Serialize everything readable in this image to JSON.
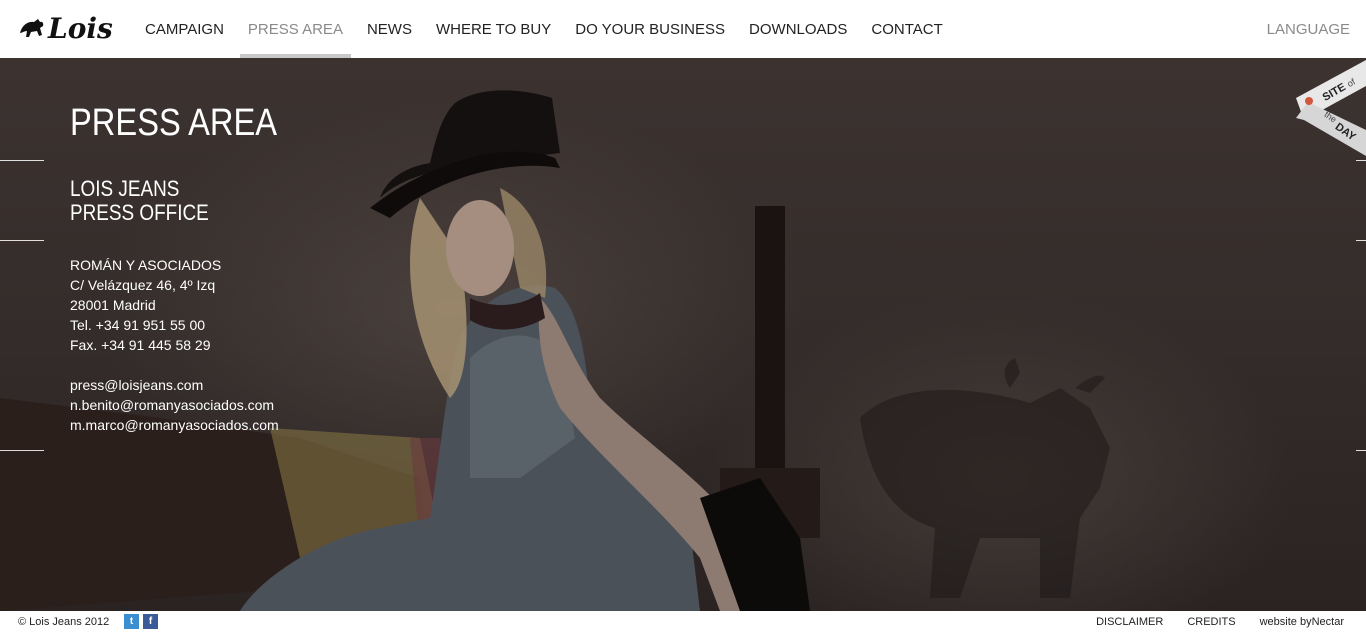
{
  "brand": {
    "logo_text": "Lois"
  },
  "nav": {
    "items": [
      {
        "label": "CAMPAIGN"
      },
      {
        "label": "PRESS AREA"
      },
      {
        "label": "NEWS"
      },
      {
        "label": "WHERE TO BUY"
      },
      {
        "label": "DO YOUR BUSINESS"
      },
      {
        "label": "DOWNLOADS"
      },
      {
        "label": "CONTACT"
      }
    ],
    "active": "PRESS AREA",
    "language": "LANGUAGE"
  },
  "main": {
    "title": "PRESS AREA",
    "office_line1": "LOIS JEANS",
    "office_line2": "PRESS OFFICE",
    "address": [
      "ROMÁN Y ASOCIADOS",
      "C/ Velázquez 46, 4º Izq",
      "28001 Madrid",
      "Tel. +34 91 951 55 00",
      "Fax. +34 91 445 58 29"
    ],
    "emails": [
      "press@loisjeans.com",
      "n.benito@romanyasociados.com",
      "m.marco@romanyasociados.com"
    ]
  },
  "badge": {
    "line1": "SITE",
    "line1b": "of",
    "line2": "the",
    "line2b": "DAY"
  },
  "footer": {
    "copyright": "© Lois Jeans 2012",
    "social": [
      "twitter-icon",
      "facebook-icon"
    ],
    "links": [
      "DISCLAIMER",
      "CREDITS"
    ],
    "credit_prefix": "website by ",
    "credit_link": "Nectar"
  },
  "colors": {
    "active_nav": "#8a8a8a",
    "active_underline": "#c9c9c9",
    "twitter": "#3b8fd0",
    "facebook": "#3b5b98"
  }
}
